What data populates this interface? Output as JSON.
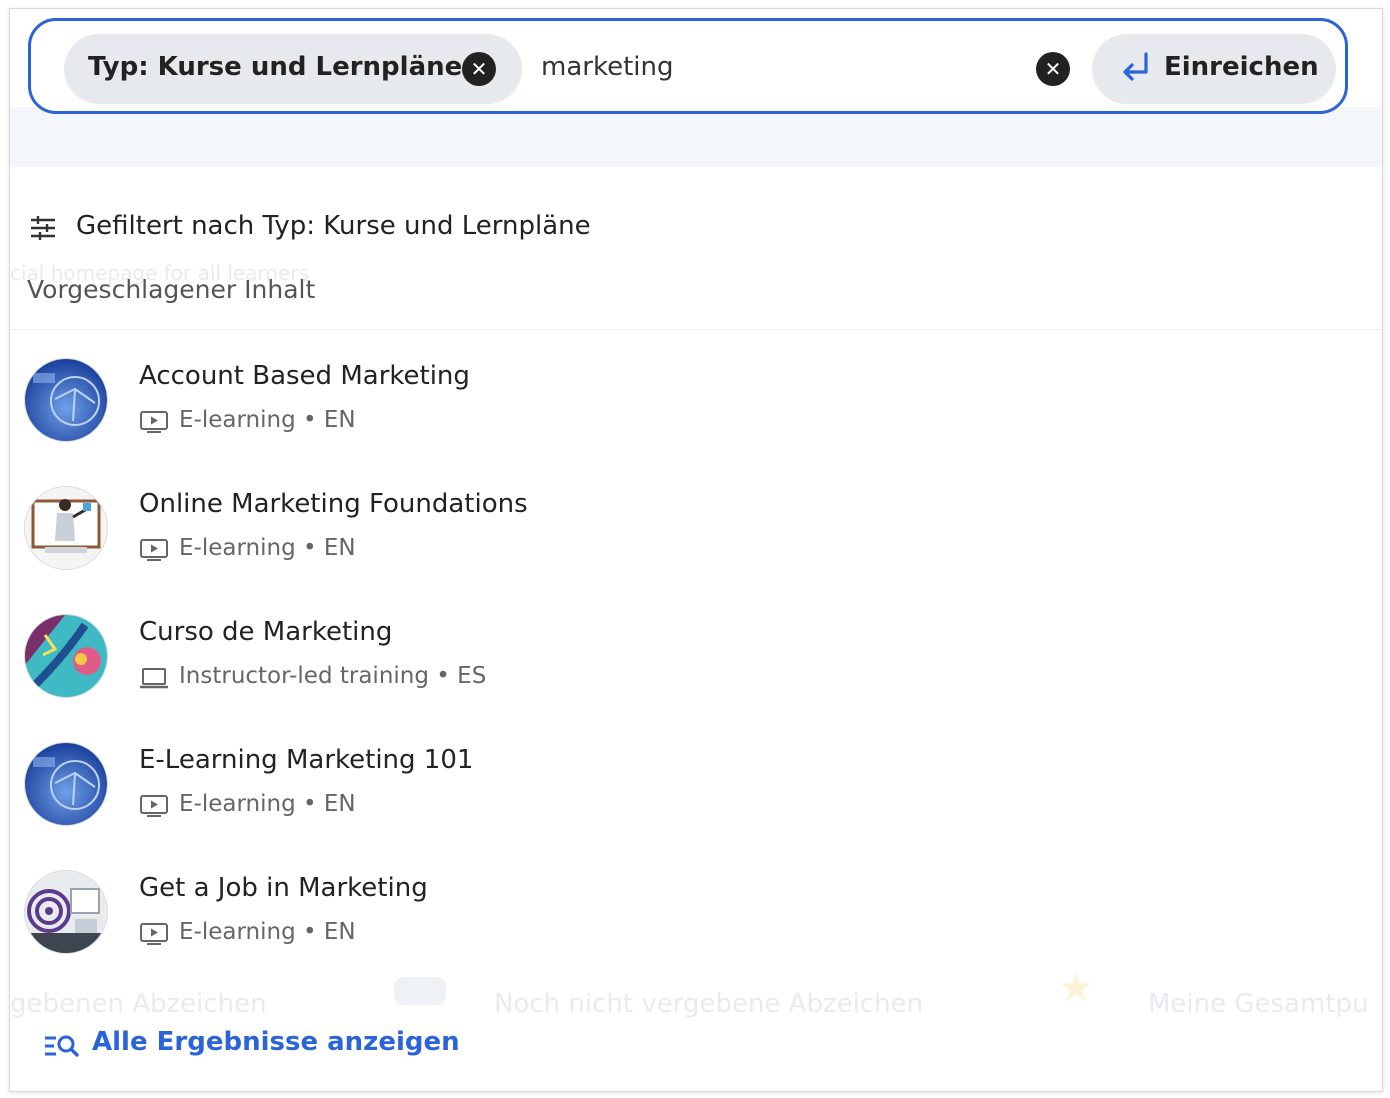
{
  "search": {
    "chip_label": "Typ: Kurse und Lernpläne",
    "query": "marketing",
    "submit_label": "Einreichen"
  },
  "filter": {
    "label": "Gefiltert nach Typ: Kurse und Lernpläne"
  },
  "suggestions": {
    "title": "Vorgeschlagener Inhalt",
    "items": [
      {
        "title": "Account Based Marketing",
        "meta": "E-learning • EN",
        "type_icon": "play-screen-icon"
      },
      {
        "title": "Online Marketing Foundations",
        "meta": "E-learning • EN",
        "type_icon": "play-screen-icon"
      },
      {
        "title": "Curso de Marketing",
        "meta": "Instructor-led training • ES",
        "type_icon": "laptop-icon"
      },
      {
        "title": "E-Learning Marketing 101",
        "meta": "E-learning • EN",
        "type_icon": "play-screen-icon"
      },
      {
        "title": "Get a Job in Marketing",
        "meta": "E-learning • EN",
        "type_icon": "play-screen-icon"
      }
    ]
  },
  "footer": {
    "all_results_label": "Alle Ergebnisse anzeigen"
  },
  "background": {
    "text_1": "cial homepage for all learners",
    "text_2": "gebenen Abzeichen",
    "text_3": "Noch nicht vergebene Abzeichen",
    "text_4": "Meine Gesamtpu"
  },
  "colors": {
    "accent": "#2b63d9",
    "chip_bg": "#e6e9ed"
  }
}
